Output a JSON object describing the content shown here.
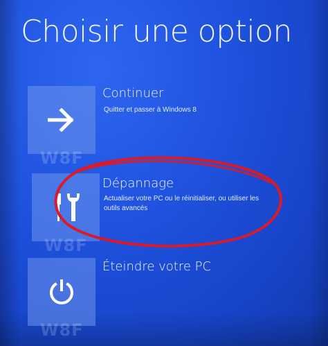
{
  "screen": {
    "title": "Choisir une option"
  },
  "options": [
    {
      "id": "continue",
      "icon": "arrow-right-icon",
      "title": "Continuer",
      "description": "Quitter et passer à Windows 8",
      "watermark": "W8F"
    },
    {
      "id": "troubleshoot",
      "icon": "wrench-screwdriver-icon",
      "title": "Dépannage",
      "description": "Actualiser votre PC ou le réinitialiser, ou utiliser les outils avancés",
      "watermark": "W8F"
    },
    {
      "id": "shutdown",
      "icon": "power-icon",
      "title": "Éteindre votre PC",
      "description": "",
      "watermark": "W8F"
    }
  ],
  "colors": {
    "background": "#1f52de",
    "tile": "#6e96eb",
    "annotation_circle": "#d81b2a"
  }
}
